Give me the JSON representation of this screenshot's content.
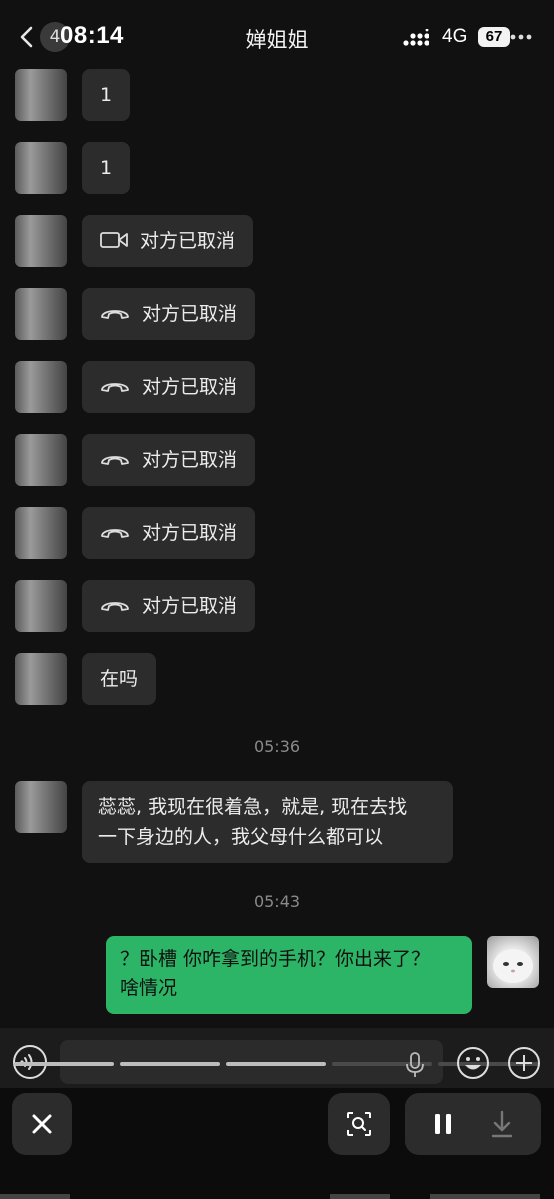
{
  "status_bar": {
    "back_badge": "4",
    "time": "08:14",
    "network": "4G",
    "battery": "67"
  },
  "chat": {
    "title": "婵姐姐"
  },
  "messages": [
    {
      "text": "1"
    },
    {
      "text": "1"
    },
    {
      "icon": "video-camera-icon",
      "text": "对方已取消"
    },
    {
      "icon": "hang-up-phone-icon",
      "text": "对方已取消"
    },
    {
      "icon": "hang-up-phone-icon",
      "text": "对方已取消"
    },
    {
      "icon": "hang-up-phone-icon",
      "text": "对方已取消"
    },
    {
      "icon": "hang-up-phone-icon",
      "text": "对方已取消"
    },
    {
      "icon": "hang-up-phone-icon",
      "text": "对方已取消"
    },
    {
      "text": "在吗"
    }
  ],
  "timestamps": [
    "05:36",
    "05:43"
  ],
  "long_message": {
    "line1": "蕊蕊, 我现在很着急，就是, 现在去找",
    "line2": "一下身边的人，我父母什么都可以"
  },
  "outgoing_message": {
    "line1": "？卧槽 你咋拿到的手机？你出来了？",
    "line2": "啥情况"
  },
  "colors": {
    "background": "#111111",
    "incoming_bubble": "#2c2c2c",
    "outgoing_bubble": "#2db567"
  }
}
